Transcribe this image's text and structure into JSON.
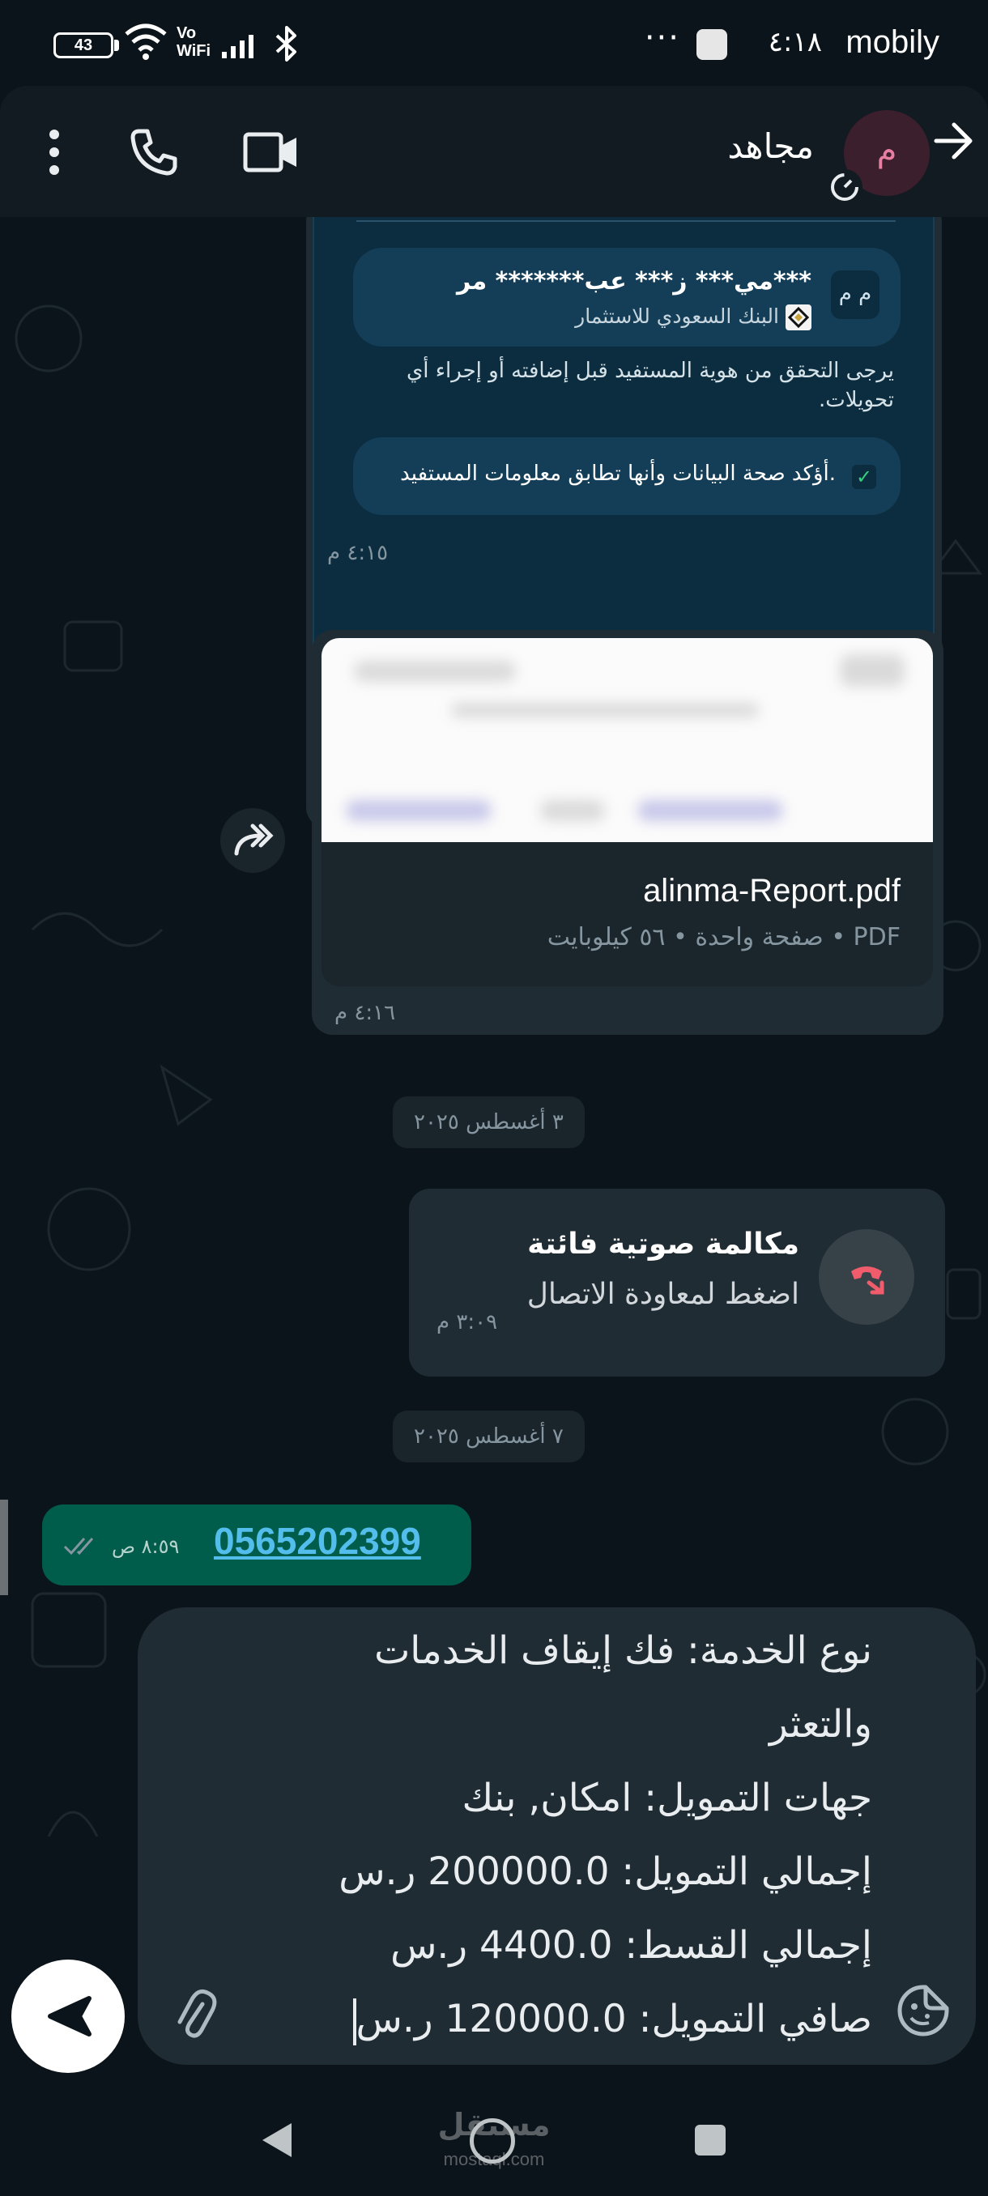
{
  "status_bar": {
    "carrier": "mobily",
    "time": "٤:١٨",
    "overflow": "···",
    "battery": "43",
    "wifi_label_top": "Vo",
    "wifi_label_bottom": "WiFi",
    "icons": [
      "battery-icon",
      "wifi-icon",
      "vowifi-icon",
      "signal-icon",
      "bluetooth-icon"
    ]
  },
  "header": {
    "contact_name": "مجاهد",
    "avatar_initial": "م",
    "icons": [
      "back-arrow-icon",
      "disappearing-timer-icon",
      "video-call-icon",
      "voice-call-icon",
      "more-options-icon"
    ]
  },
  "messages": {
    "bank_card": {
      "initials": "م م",
      "account_name": "مي*** ز*** عب******* مر***",
      "bank_name": "البنك السعودي للاستثمار",
      "verify_note": "يرجى التحقق من هوية المستفيد قبل إضافته أو إجراء أي تحويلات.",
      "confirm_text": "أؤكد صحة البيانات وأنها تطابق معلومات المستفيد.",
      "time": "٤:١٥ م"
    },
    "pdf": {
      "file_name": "alinma-Report.pdf",
      "meta": "صفحة واحدة • ٥٦ كيلوبايت • PDF",
      "time": "٤:١٦ م"
    },
    "date_1": "٣ أغسطس ٢٠٢٥",
    "missed_call": {
      "title": "مكالمة صوتية فائتة",
      "subtitle": "اضغط لمعاودة الاتصال",
      "time": "٣:٠٩ م"
    },
    "date_2": "٧ أغسطس ٢٠٢٥",
    "outgoing": {
      "text": "0565202399",
      "time": "٨:٥٩ ص",
      "status": "read"
    }
  },
  "composer": {
    "lines": [
      "نوع الخدمة: فك إيقاف الخدمات",
      "والتعثر",
      "جهات التمويل: امكان, بنك",
      "إجمالي التمويل: 200000.0 ر.س",
      "إجمالي القسط: 4400.0 ر.س",
      "صافي التمويل: 120000.0 ر.س"
    ]
  },
  "nav": {
    "watermark": "مستقل",
    "watermark_sub": "mostaql.com"
  },
  "colors": {
    "background": "#0b141a",
    "incoming_bubble": "#202c33",
    "outgoing_bubble": "#005c4b",
    "link": "#53bdeb",
    "missed_call_red": "#f15c6d",
    "bank_card": "#0c2d3f"
  }
}
